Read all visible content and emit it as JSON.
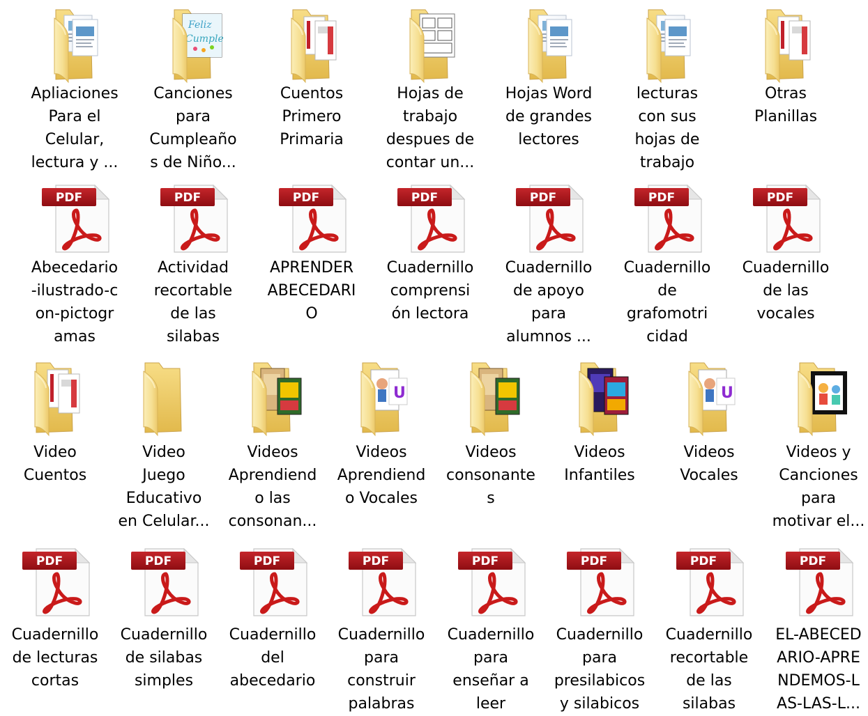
{
  "window": {
    "title": ""
  },
  "rows": [
    {
      "kind": "folder",
      "items": [
        {
          "label": "Apliaciones\nPara el\nCelular,\nlectura y ...",
          "thumb": "doc"
        },
        {
          "label": "Canciones\npara\nCumpleaño\ns de Niño...",
          "thumb": "feliz"
        },
        {
          "label": "Cuentos\nPrimero\nPrimaria",
          "thumb": "pages"
        },
        {
          "label": "Hojas de\ntrabajo\ndespues de\ncontar un...",
          "thumb": "worksheet"
        },
        {
          "label": "Hojas Word\nde grandes\nlectores",
          "thumb": "doc"
        },
        {
          "label": "lecturas\ncon sus\nhojas de\ntrabajo",
          "thumb": "doc"
        },
        {
          "label": "Otras\nPlanillas",
          "thumb": "pages"
        }
      ]
    },
    {
      "kind": "pdf",
      "items": [
        {
          "label": "Abecedario\n-ilustrado-c\non-pictogr\namas"
        },
        {
          "label": "Actividad\nrecortable\nde las\nsilabas"
        },
        {
          "label": "APRENDER\nABECEDARI\nO"
        },
        {
          "label": "Cuadernillo\ncomprensi\nón lectora"
        },
        {
          "label": "Cuadernillo\nde apoyo\npara\nalumnos ..."
        },
        {
          "label": "Cuadernillo\nde\ngrafomotri\ncidad"
        },
        {
          "label": "Cuadernillo\nde las\nvocales"
        }
      ]
    },
    {
      "kind": "folder",
      "items": [
        {
          "label": "Video\nCuentos",
          "thumb": "pages"
        },
        {
          "label": "Video\nJuego\nEducativo\nen Celular...",
          "thumb": "empty"
        },
        {
          "label": "Videos\nAprendiend\no las\nconsonan...",
          "thumb": "video"
        },
        {
          "label": "Videos\nAprendiend\no Vocales",
          "thumb": "vocal"
        },
        {
          "label": "Videos\nconsonante\ns",
          "thumb": "video"
        },
        {
          "label": "Videos\nInfantiles",
          "thumb": "dark"
        },
        {
          "label": "Videos\nVocales",
          "thumb": "vocal"
        },
        {
          "label": "Videos y\nCanciones\npara\nmotivar el...",
          "thumb": "frame"
        }
      ]
    },
    {
      "kind": "pdf",
      "items": [
        {
          "label": "Cuadernillo\nde lecturas\ncortas"
        },
        {
          "label": "Cuadernillo\nde silabas\nsimples"
        },
        {
          "label": "Cuadernillo\ndel\nabecedario"
        },
        {
          "label": "Cuadernillo\npara\nconstruir\npalabras"
        },
        {
          "label": "Cuadernillo\npara\nenseñar a\nleer"
        },
        {
          "label": "Cuadernillo\npara\npresilabicos\ny silabicos"
        },
        {
          "label": "Cuadernillo\nrecortable\nde las\nsilabas"
        },
        {
          "label": "EL-ABECED\nARIO-APRE\nNDEMOS-L\nAS-LAS-L..."
        }
      ]
    }
  ],
  "pdf_badge": "PDF",
  "icons": {
    "folder": "folder-icon",
    "pdf": "pdf-file-icon"
  },
  "colors": {
    "folder_light": "#fbe9a8",
    "folder_dark": "#e7c25c",
    "pdf_red": "#c41a1a",
    "pdf_badge": "#a50f16"
  }
}
